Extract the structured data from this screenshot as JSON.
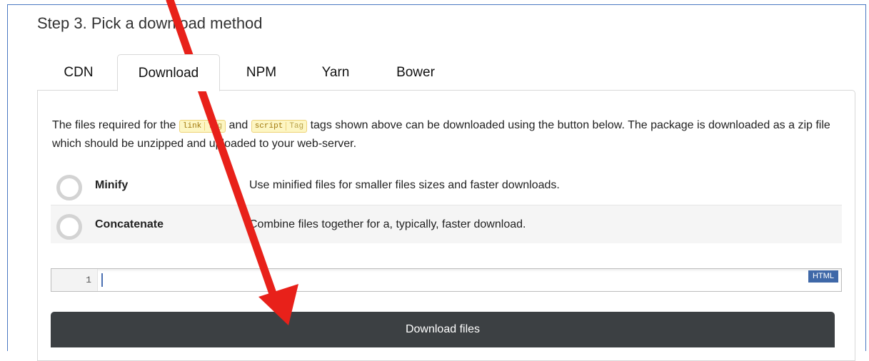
{
  "step_title": "Step 3. Pick a download method",
  "tabs": [
    {
      "label": "CDN",
      "active": false
    },
    {
      "label": "Download",
      "active": true
    },
    {
      "label": "NPM",
      "active": false
    },
    {
      "label": "Yarn",
      "active": false
    },
    {
      "label": "Bower",
      "active": false
    }
  ],
  "description": {
    "part1": "The files required for the",
    "link_tag_name": "link",
    "tag_label": "Tag",
    "part2": "and",
    "script_tag_name": "script",
    "part3": "tags shown above can be downloaded using the button below. The package is downloaded as a zip file which should be unzipped and uploaded to your web-server."
  },
  "options": [
    {
      "label": "Minify",
      "description": "Use minified files for smaller files sizes and faster downloads.",
      "enabled": false
    },
    {
      "label": "Concatenate",
      "description": "Combine files together for a, typically, faster download.",
      "enabled": false
    }
  ],
  "editor": {
    "line_number": "1",
    "language": "HTML"
  },
  "download_button": "Download files",
  "colors": {
    "arrow": "#e8211a",
    "button": "#3c4043",
    "frame": "#4a78c2"
  }
}
